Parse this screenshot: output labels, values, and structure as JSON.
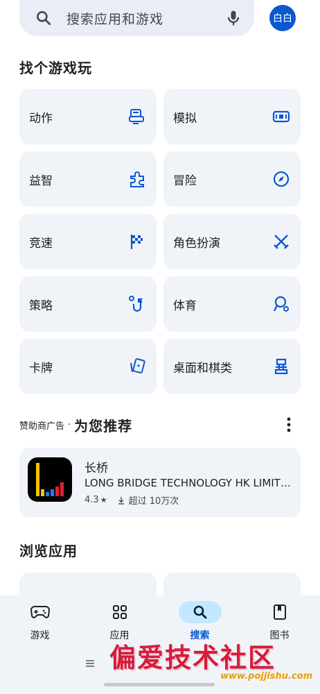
{
  "search": {
    "placeholder": "搜索应用和游戏",
    "avatar_text": "白白"
  },
  "games_section": {
    "title": "找个游戏玩",
    "categories": [
      {
        "label": "动作",
        "icon": "action-game-icon"
      },
      {
        "label": "模拟",
        "icon": "simulation-icon"
      },
      {
        "label": "益智",
        "icon": "puzzle-icon"
      },
      {
        "label": "冒险",
        "icon": "compass-icon"
      },
      {
        "label": "竞速",
        "icon": "checkered-flag-icon"
      },
      {
        "label": "角色扮演",
        "icon": "crossed-swords-icon"
      },
      {
        "label": "策略",
        "icon": "strategy-icon"
      },
      {
        "label": "体育",
        "icon": "sports-icon"
      },
      {
        "label": "卡牌",
        "icon": "cards-icon"
      },
      {
        "label": "桌面和棋类",
        "icon": "chess-piece-icon"
      }
    ]
  },
  "recommend": {
    "ad_label": "赞助商广告",
    "dot": "·",
    "title": "为您推荐",
    "app": {
      "name": "长桥",
      "developer": "LONG BRIDGE TECHNOLOGY HK LIMIT…",
      "rating": "4.3",
      "rating_star": "★",
      "downloads": "超过 10万次"
    }
  },
  "browse": {
    "title": "浏览应用"
  },
  "bottom_nav": {
    "items": [
      {
        "label": "游戏",
        "icon": "gamepad-icon",
        "active": false
      },
      {
        "label": "应用",
        "icon": "apps-grid-icon",
        "active": false
      },
      {
        "label": "搜索",
        "icon": "search-icon",
        "active": true
      },
      {
        "label": "图书",
        "icon": "book-icon",
        "active": false
      }
    ]
  },
  "watermark": {
    "text": "偏爱技术社区",
    "url": "www.pojjishu.com"
  },
  "colors": {
    "accent": "#0b57d0",
    "card_bg": "#f0f4f9",
    "active_pill": "#c2e7ff"
  }
}
